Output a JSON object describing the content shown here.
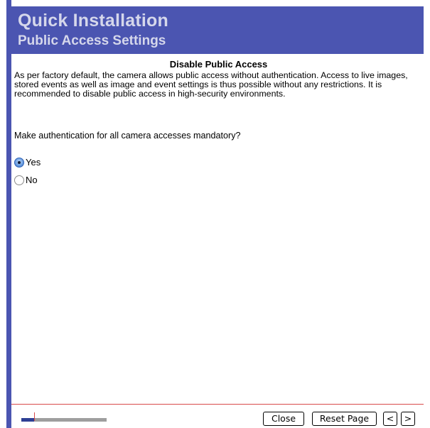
{
  "header": {
    "title": "Quick Installation",
    "subtitle": "Public Access Settings"
  },
  "content": {
    "section_title": "Disable Public Access",
    "description": "As per factory default, the camera allows public access without authentication. Access to live images, stored events as well as image and event settings is thus possible without any restrictions. It is recommended to disable public access in high-security environments.",
    "question": "Make authentication for all camera accesses mandatory?",
    "options": [
      {
        "label": "Yes",
        "selected": true
      },
      {
        "label": "No",
        "selected": false
      }
    ]
  },
  "footer": {
    "progress": 0.15,
    "buttons": {
      "close": "Close",
      "reset": "Reset Page",
      "prev": "<",
      "next": ">"
    }
  },
  "colors": {
    "header_bg": "#4b55b1",
    "header_text": "#d5d7eb",
    "accent_line": "#d84a4a",
    "progress_fill": "#2e3f94",
    "progress_track": "#9e9e9e"
  }
}
